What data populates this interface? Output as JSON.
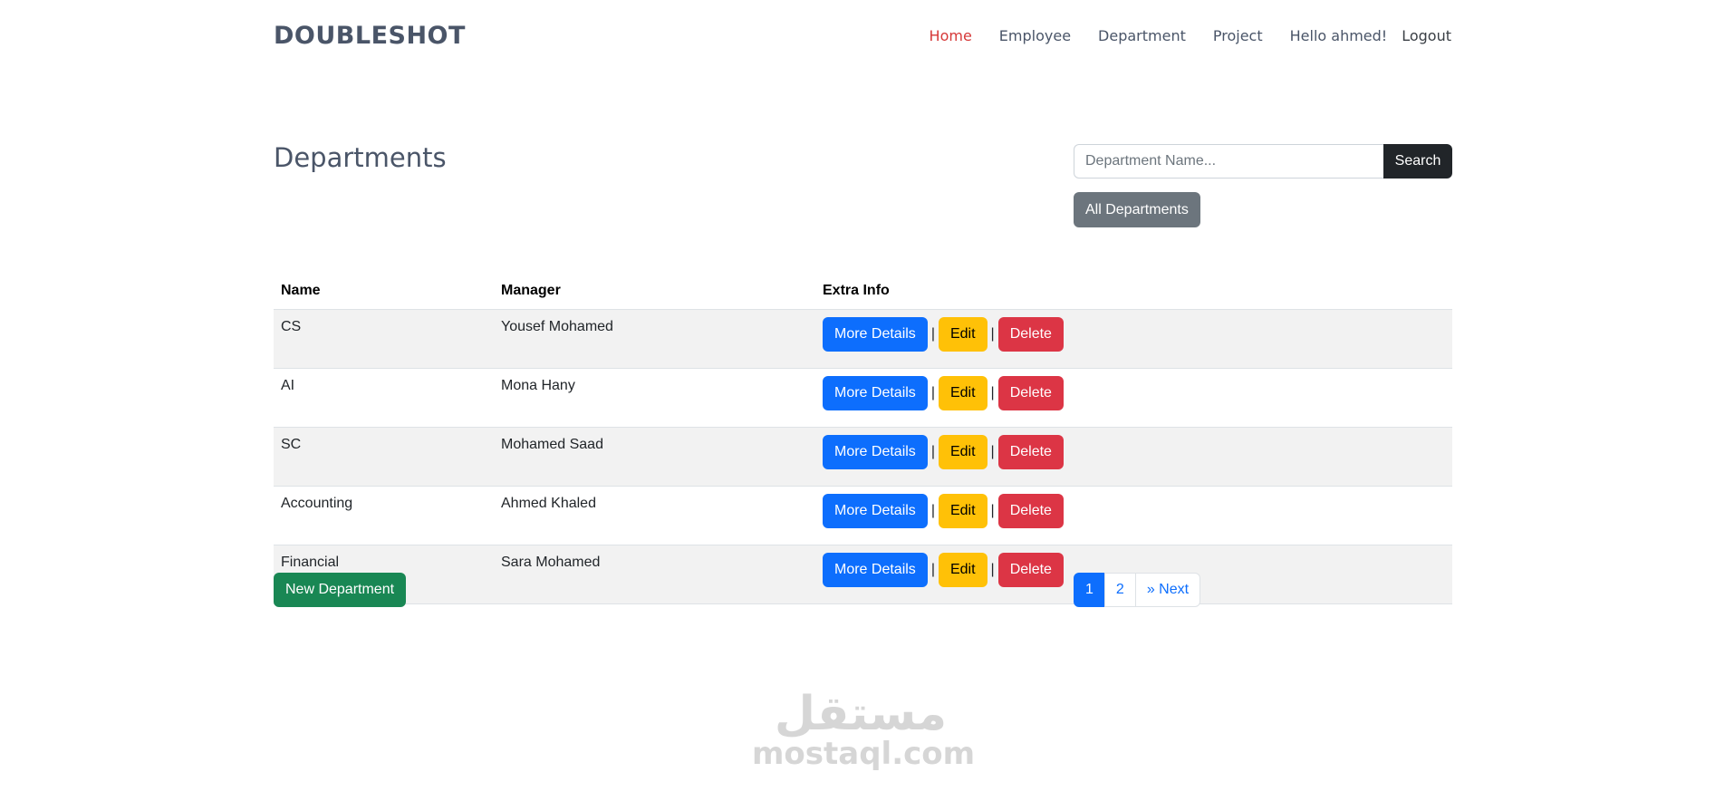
{
  "brand": "DOUBLESHOT",
  "nav": {
    "items": [
      "Home",
      "Employee",
      "Department",
      "Project"
    ],
    "greeting": "Hello ahmed!",
    "logout": "Logout"
  },
  "page_title": "Departments",
  "search": {
    "placeholder": "Department Name...",
    "value": "",
    "button": "Search"
  },
  "all_departments": "All Departments",
  "table": {
    "headers": [
      "Name",
      "Manager",
      "Extra Info"
    ],
    "rows": [
      {
        "name": "CS",
        "manager": "Yousef Mohamed"
      },
      {
        "name": "AI",
        "manager": "Mona Hany"
      },
      {
        "name": "SC",
        "manager": "Mohamed Saad"
      },
      {
        "name": "Accounting",
        "manager": "Ahmed Khaled"
      },
      {
        "name": "Financial",
        "manager": "Sara Mohamed"
      }
    ],
    "actions": {
      "details": "More Details",
      "edit": "Edit",
      "delete": "Delete",
      "separator": "|"
    }
  },
  "new_department": "New Department",
  "pagination": {
    "pages": [
      "1",
      "2"
    ],
    "next": "» Next",
    "current": "1"
  },
  "watermark": {
    "arabic": "مستقل",
    "latin": "mostaql.com"
  },
  "colors": {
    "active_nav": "#d63838",
    "primary": "#0d6efd",
    "warning": "#ffc107",
    "danger": "#dc3545",
    "success": "#198754",
    "secondary": "#6c757d",
    "dark": "#212529"
  }
}
